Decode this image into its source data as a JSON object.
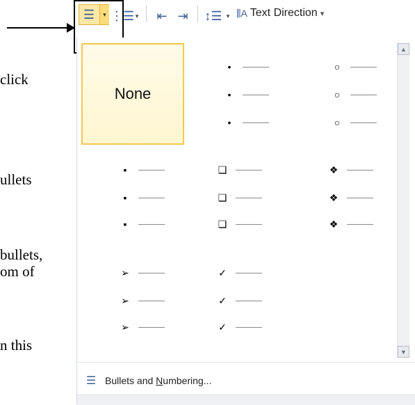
{
  "document_fragments": [
    "click",
    "ullets",
    "bullets,",
    "om of",
    "n this"
  ],
  "toolbar": {
    "bullets_icon": "bullets-list-icon",
    "numbering_icon": "numbered-list-icon",
    "decrease_indent_icon": "decrease-indent-icon",
    "increase_indent_icon": "increase-indent-icon",
    "line_spacing_icon": "line-spacing-icon",
    "text_direction_label": "Text Direction",
    "text_direction_arrow": "▾"
  },
  "dropdown": {
    "none_label": "None",
    "bullet_styles": [
      {
        "name": "small-round",
        "glyph": "•"
      },
      {
        "name": "hollow-circle",
        "glyph": "○"
      },
      {
        "name": "filled-square",
        "glyph": "▪"
      },
      {
        "name": "hollow-square",
        "glyph": "❑"
      },
      {
        "name": "diamond-cluster",
        "glyph": "❖"
      },
      {
        "name": "arrow",
        "glyph": "➢"
      },
      {
        "name": "checkmark",
        "glyph": "✓"
      }
    ],
    "menu_item": {
      "prefix": "Bullets and ",
      "underline": "N",
      "suffix": "umbering..."
    }
  },
  "colors": {
    "selected_border": "#f2c94c",
    "accent": "#3a5d96"
  }
}
